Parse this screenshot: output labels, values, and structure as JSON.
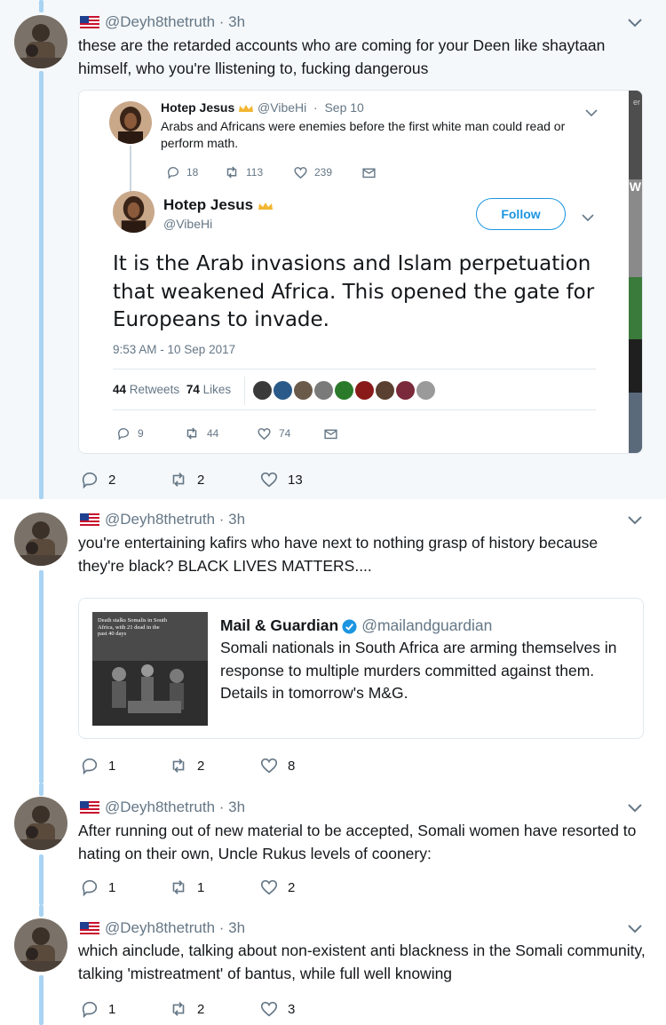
{
  "colors": {
    "thread_line": "#a9d3f2",
    "link_blue": "#1b95e0",
    "muted": "#657786",
    "highlight_bg": "#f5f8fa"
  },
  "tweets": [
    {
      "author": "@Deyh8thetruth",
      "time": "3h",
      "text": "these are the retarded accounts who are coming for your Deen like shaytaan himself, who you're llistening to, fucking dangerous",
      "replies": "2",
      "retweets": "2",
      "likes": "13"
    },
    {
      "author": "@Deyh8thetruth",
      "time": "3h",
      "text": "you're entertaining kafirs who have next to nothing grasp of history because they're black? BLACK LIVES MATTERS....",
      "replies": "1",
      "retweets": "2",
      "likes": "8"
    },
    {
      "author": "@Deyh8thetruth",
      "time": "3h",
      "text": "After running out of new material to be accepted, Somali women have resorted to hating on their own, Uncle Rukus levels of coonery:",
      "replies": "1",
      "retweets": "1",
      "likes": "2"
    },
    {
      "author": "@Deyh8thetruth",
      "time": "3h",
      "text": "which ainclude, talking about non-existent anti blackness in the Somali community, talking 'mistreatment' of bantus, while full well knowing",
      "replies": "1",
      "retweets": "2",
      "likes": "3"
    }
  ],
  "quote1": {
    "parent": {
      "name": "Hotep Jesus",
      "handle": "@VibeHi",
      "date": "Sep 10",
      "text": "Arabs and Africans were enemies before the first white man could read or perform math.",
      "replies": "18",
      "retweets": "113",
      "likes": "239"
    },
    "main": {
      "name": "Hotep Jesus",
      "handle": "@VibeHi",
      "follow_label": "Follow",
      "text": "It is the Arab invasions and Islam perpetuation that weakened Africa. This opened the gate for Europeans to invade.",
      "timestamp": "9:53 AM - 10 Sep 2017",
      "retweets_count": "44",
      "retweets_label": "Retweets",
      "likes_count": "74",
      "likes_label": "Likes",
      "replies": "9",
      "retweets": "44",
      "likes": "74"
    },
    "edge_text": {
      "top": "er",
      "mid": "W"
    }
  },
  "quote2": {
    "name": "Mail & Guardian",
    "handle": "@mailandguardian",
    "text": "Somali nationals in South Africa are arming themselves in response to multiple murders committed against them. Details in tomorrow's M&G.",
    "thumb_caption": "Death stalks Somalis in South Africa, with 21 dead in the past 40 days"
  }
}
